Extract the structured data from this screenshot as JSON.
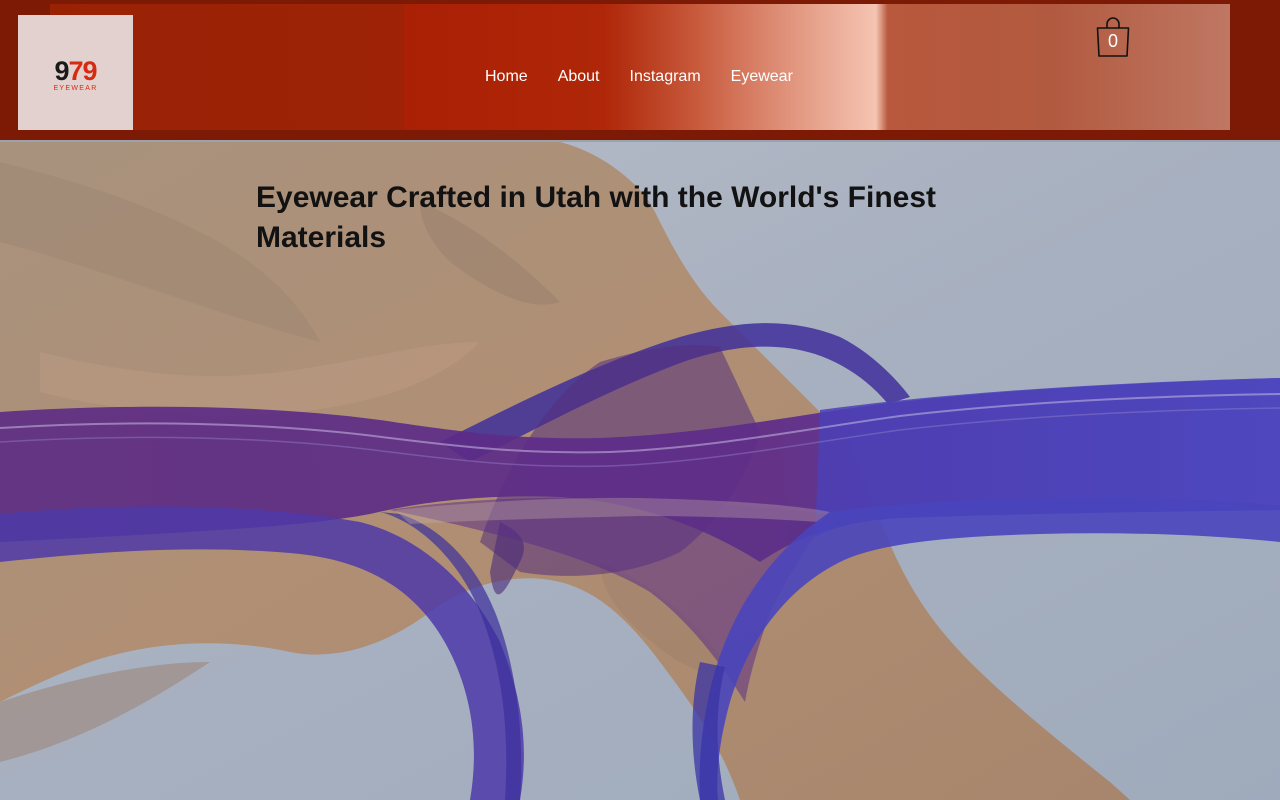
{
  "brand": {
    "logo_number_a": "9",
    "logo_number_b": "79",
    "logo_subtitle": "EYEWEAR",
    "accent_color": "#d62b10",
    "header_color": "#7c1a05"
  },
  "nav": {
    "items": [
      {
        "label": "Home"
      },
      {
        "label": "About"
      },
      {
        "label": "Instagram"
      },
      {
        "label": "Eyewear"
      }
    ]
  },
  "cart": {
    "icon": "shopping-bag-icon",
    "count": "0"
  },
  "hero": {
    "title": "Eyewear Crafted in Utah with the World's Finest Materials",
    "image_description_icon": "glasses-over-rock-arch-photo"
  }
}
